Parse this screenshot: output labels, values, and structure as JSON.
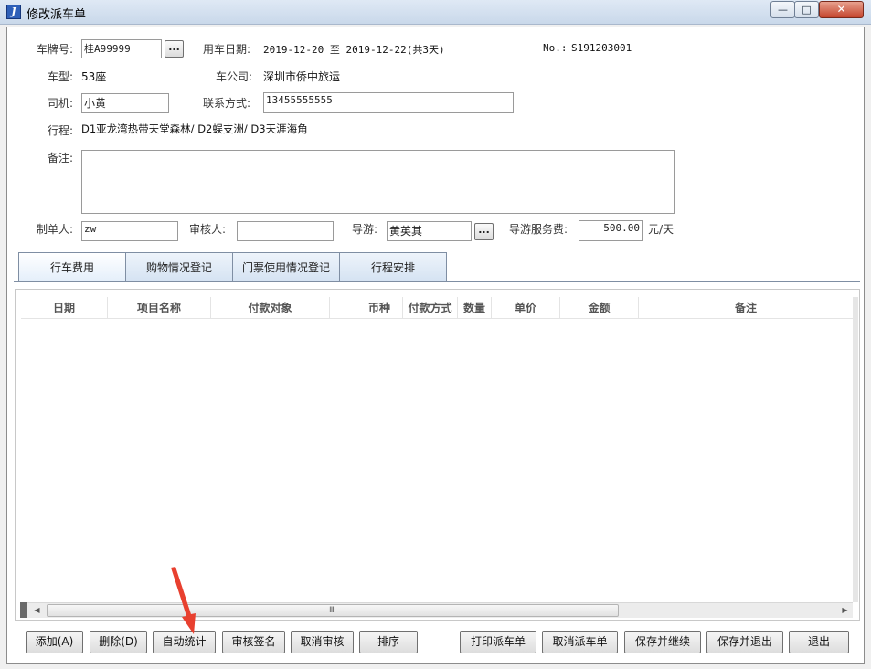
{
  "window": {
    "title": "修改派车单",
    "icon_glyph": "J"
  },
  "form": {
    "plate_label": "车牌号:",
    "plate_value": "桂A99999",
    "date_label": "用车日期:",
    "date_value": "2019-12-20 至 2019-12-22(共3天)",
    "no_label": "No.:",
    "no_value": "S191203001",
    "type_label": "车型:",
    "type_value": "53座",
    "company_label": "车公司:",
    "company_value": "深圳市侨中旅运",
    "driver_label": "司机:",
    "driver_value": "小黄",
    "contact_label": "联系方式:",
    "contact_value": "13455555555",
    "route_label": "行程:",
    "route_value": "D1亚龙湾热带天堂森林/ D2蜈支洲/ D3天涯海角",
    "note_label": "备注:",
    "note_value": "",
    "maker_label": "制单人:",
    "maker_value": "zw",
    "auditor_label": "审核人:",
    "auditor_value": "",
    "guide_label": "导游:",
    "guide_value": "黄英其",
    "fee_label": "导游服务费:",
    "fee_value": "500.00",
    "fee_unit": "元/天",
    "dots": "..."
  },
  "tabs": [
    "行车费用",
    "购物情况登记",
    "门票使用情况登记",
    "行程安排"
  ],
  "active_tab": 0,
  "grid": {
    "columns": [
      "日期",
      "项目名称",
      "付款对象",
      "",
      "币种",
      "付款方式",
      "数量",
      "单价",
      "金额",
      "备注"
    ],
    "rows": []
  },
  "scrollbar": {
    "grip": "III",
    "left_arrow": "◀",
    "right_arrow": "▶"
  },
  "buttons": {
    "add": "添加(A)",
    "delete": "删除(D)",
    "auto_stats": "自动统计",
    "audit_sign": "审核签名",
    "cancel_audit": "取消审核",
    "sort": "排序",
    "print": "打印派车单",
    "cancel_order": "取消派车单",
    "save_continue": "保存并继续",
    "save_exit": "保存并退出",
    "exit": "退出"
  },
  "colors": {
    "annotation_arrow": "#e8402f",
    "tab_border": "#7f8ea3",
    "title_gradient_top": "#dfe9f5"
  }
}
